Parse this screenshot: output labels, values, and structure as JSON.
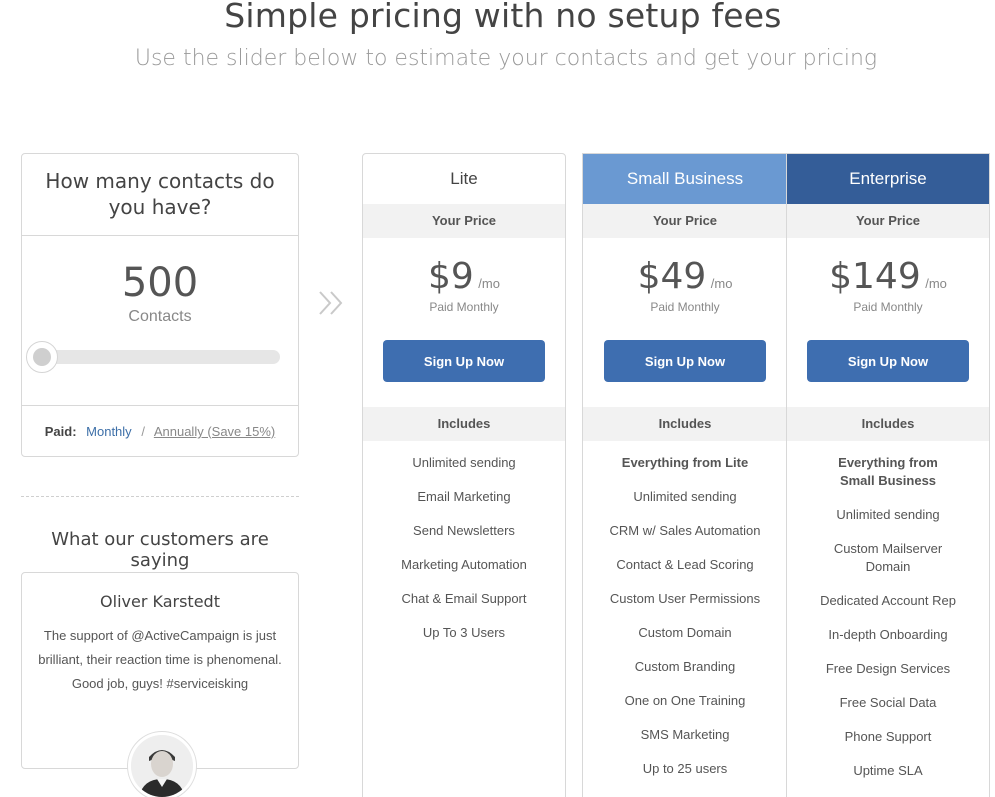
{
  "header": {
    "title": "Simple pricing with no setup fees",
    "subtitle": "Use the slider below to estimate your contacts and get your pricing"
  },
  "contacts": {
    "question": "How many contacts do you have?",
    "count": "500",
    "unit": "Contacts",
    "slider_position": 0
  },
  "billing": {
    "label": "Paid:",
    "monthly": "Monthly",
    "separator": "/",
    "annually": "Annually (Save 15%)"
  },
  "testimonials": {
    "heading": "What our customers are saying",
    "name": "Oliver Karstedt",
    "quote": "The support of @ActiveCampaign is just brilliant, their reaction time is phenomenal. Good job, guys! #serviceisking"
  },
  "plans": [
    {
      "name": "Lite",
      "your_price": "Your Price",
      "amount": "$9",
      "per": "/mo",
      "paid_note": "Paid Monthly",
      "cta": "Sign Up Now",
      "includes": "Includes",
      "features": [
        "Unlimited sending",
        "Email Marketing",
        "Send Newsletters",
        "Marketing Automation",
        "Chat & Email Support",
        "Up To 3 Users"
      ]
    },
    {
      "name": "Small Business",
      "your_price": "Your Price",
      "amount": "$49",
      "per": "/mo",
      "paid_note": "Paid Monthly",
      "cta": "Sign Up Now",
      "includes": "Includes",
      "features": [
        "Everything from Lite",
        "Unlimited sending",
        "CRM w/ Sales Automation",
        "Contact & Lead Scoring",
        "Custom User Permissions",
        "Custom Domain",
        "Custom Branding",
        "One on One Training",
        "SMS Marketing",
        "Up to 25 users"
      ]
    },
    {
      "name": "Enterprise",
      "your_price": "Your Price",
      "amount": "$149",
      "per": "/mo",
      "paid_note": "Paid Monthly",
      "cta": "Sign Up Now",
      "includes": "Includes",
      "features": [
        "Everything from Small Business",
        "Unlimited sending",
        "Custom Mailserver Domain",
        "Dedicated Account Rep",
        "In-depth Onboarding",
        "Free Design Services",
        "Free Social Data",
        "Phone Support",
        "Uptime SLA"
      ]
    }
  ],
  "colors": {
    "small_business_header": "#6a99d2",
    "enterprise_header": "#345d98",
    "button": "#3e6eb0",
    "link": "#3d6fa8"
  },
  "icons": {
    "arrow": "double-chevron-right-icon"
  }
}
